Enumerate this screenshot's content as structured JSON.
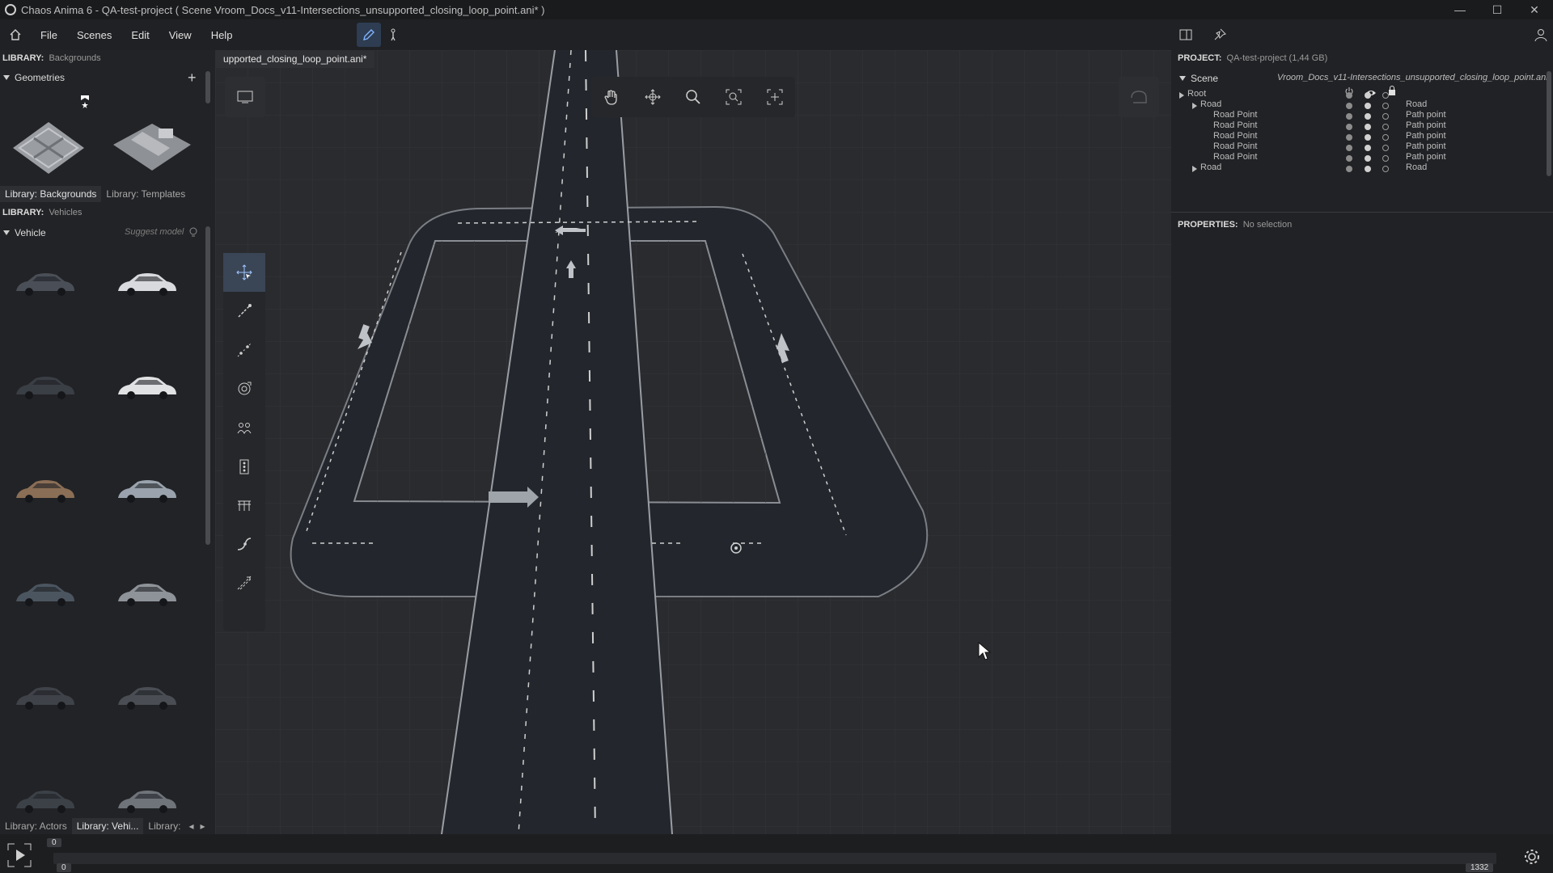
{
  "window": {
    "title": "Chaos Anima 6 -   QA-test-project ( Scene Vroom_Docs_v11-Intersections_unsupported_closing_loop_point.ani* )",
    "minimize": "—",
    "maximize": "☐",
    "close": "✕"
  },
  "menu": {
    "items": [
      "File",
      "Scenes",
      "Edit",
      "View",
      "Help"
    ]
  },
  "left_panel": {
    "library_backgrounds": {
      "label": "LIBRARY:",
      "value": "Backgrounds"
    },
    "geometries_title": "Geometries",
    "tabs_top": [
      "Library: Backgrounds",
      "Library: Templates"
    ],
    "library_vehicles": {
      "label": "LIBRARY:",
      "value": "Vehicles"
    },
    "vehicle_title": "Vehicle",
    "suggest_model": "Suggest model",
    "tabs_bottom": [
      "Library: Actors",
      "Library: Vehi...",
      "Library:"
    ]
  },
  "viewport": {
    "doc_tab": "upported_closing_loop_point.ani*"
  },
  "right_panel": {
    "project": {
      "label": "PROJECT:",
      "value": "QA-test-project (1,44 GB)"
    },
    "scene_title": "Scene",
    "scene_file": "Vroom_Docs_v11-Intersections_unsupported_closing_loop_point.ani*",
    "tree": [
      {
        "name": "Root",
        "type": "",
        "indent": 0,
        "expandable": true
      },
      {
        "name": "Road",
        "type": "Road",
        "indent": 1,
        "expandable": true
      },
      {
        "name": "Road Point",
        "type": "Path point",
        "indent": 2,
        "expandable": false
      },
      {
        "name": "Road Point",
        "type": "Path point",
        "indent": 2,
        "expandable": false
      },
      {
        "name": "Road Point",
        "type": "Path point",
        "indent": 2,
        "expandable": false
      },
      {
        "name": "Road Point",
        "type": "Path point",
        "indent": 2,
        "expandable": false
      },
      {
        "name": "Road Point",
        "type": "Path point",
        "indent": 2,
        "expandable": false
      },
      {
        "name": "Road",
        "type": "Road",
        "indent": 1,
        "expandable": true
      }
    ],
    "properties": {
      "label": "PROPERTIES:",
      "value": "No selection"
    }
  },
  "timeline": {
    "current_frame": "0",
    "start_frame": "0",
    "end_frame": "1332"
  },
  "colors": {
    "accent": "#3a4556",
    "road": "#23272d",
    "viewport_bg": "#2a2b2e"
  }
}
